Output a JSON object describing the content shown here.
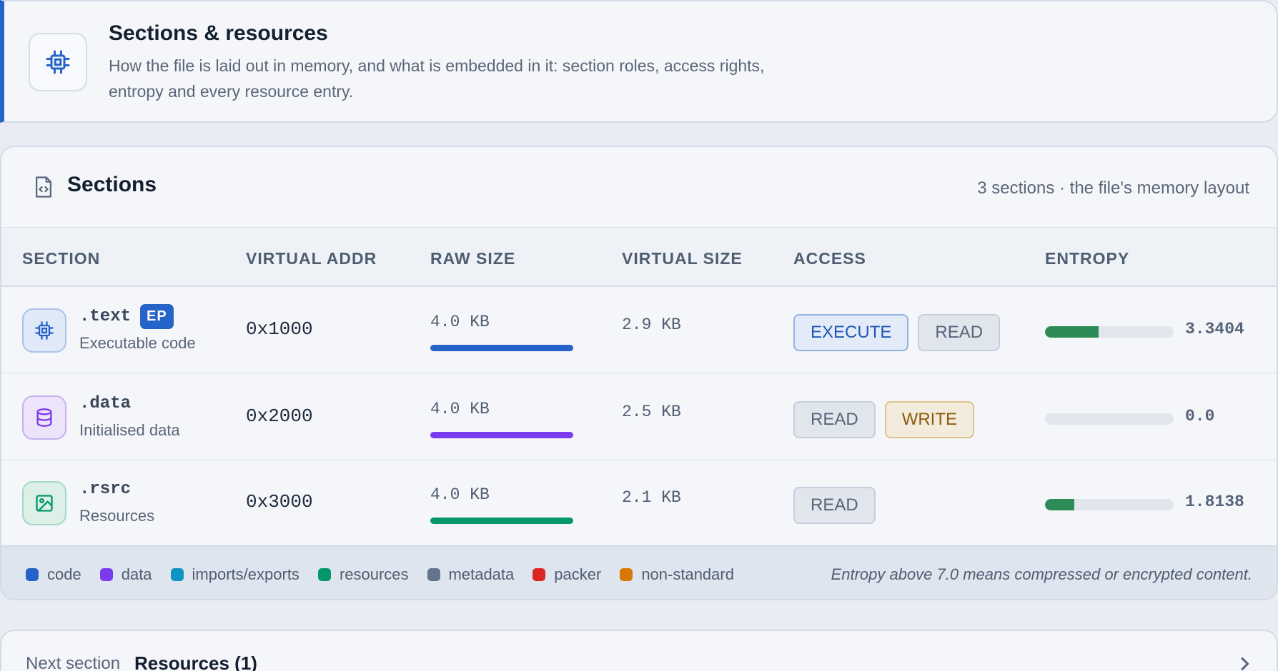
{
  "header": {
    "title": "Sections & resources",
    "description": "How the file is laid out in memory, and what is embedded in it: section roles, access rights, entropy and every resource entry.",
    "icon": "cpu-chip-icon"
  },
  "sections_card": {
    "title": "Sections",
    "icon": "file-code-icon",
    "summary": "3 sections · the file's memory layout",
    "columns": [
      "SECTION",
      "VIRTUAL ADDR",
      "RAW SIZE",
      "VIRTUAL SIZE",
      "ACCESS",
      "ENTROPY"
    ],
    "rows": [
      {
        "name": ".text",
        "badge": "EP",
        "role": "Executable code",
        "icon": "cpu-chip-icon",
        "virtual_addr": "0x1000",
        "raw_size": "4.0 KB",
        "virtual_size": "2.9 KB",
        "access": [
          "EXECUTE",
          "READ"
        ],
        "entropy": "3.3404",
        "entropy_value": 3.3404,
        "color": "#2563c9"
      },
      {
        "name": ".data",
        "badge": "",
        "role": "Initialised data",
        "icon": "database-icon",
        "virtual_addr": "0x2000",
        "raw_size": "4.0 KB",
        "virtual_size": "2.5 KB",
        "access": [
          "READ",
          "WRITE"
        ],
        "entropy": "0.0",
        "entropy_value": 0.0,
        "color": "#7c3aed"
      },
      {
        "name": ".rsrc",
        "badge": "",
        "role": "Resources",
        "icon": "image-icon",
        "virtual_addr": "0x3000",
        "raw_size": "4.0 KB",
        "virtual_size": "2.1 KB",
        "access": [
          "READ"
        ],
        "entropy": "1.8138",
        "entropy_value": 1.8138,
        "color": "#059669"
      }
    ],
    "legend": [
      {
        "label": "code",
        "color": "#2563c9"
      },
      {
        "label": "data",
        "color": "#7c3aed"
      },
      {
        "label": "imports/exports",
        "color": "#0e94c0"
      },
      {
        "label": "resources",
        "color": "#059669"
      },
      {
        "label": "metadata",
        "color": "#64748b"
      },
      {
        "label": "packer",
        "color": "#dc2626"
      },
      {
        "label": "non-standard",
        "color": "#d97706"
      }
    ],
    "legend_note": "Entropy above 7.0 means compressed or encrypted content."
  },
  "next_section": {
    "label": "Next section",
    "title": "Resources (1)",
    "icon": "chevron-right-icon"
  }
}
